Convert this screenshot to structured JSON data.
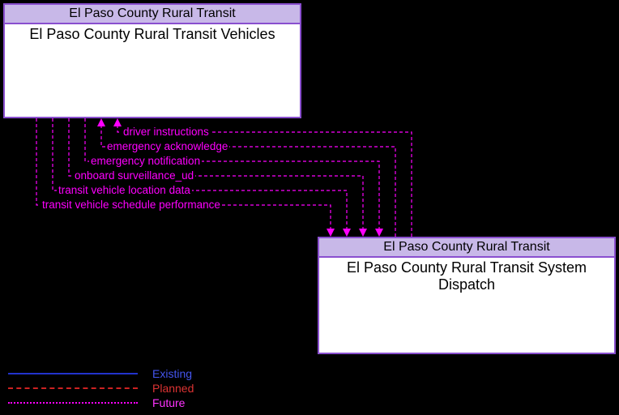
{
  "boxes": {
    "top": {
      "header": "El Paso County Rural Transit",
      "body": "El Paso County Rural Transit Vehicles"
    },
    "bottom": {
      "header": "El Paso County Rural Transit",
      "body": "El Paso County Rural Transit System Dispatch"
    }
  },
  "flows": [
    {
      "label": "driver instructions",
      "dir": "to_top"
    },
    {
      "label": "emergency acknowledge",
      "dir": "to_top"
    },
    {
      "label": "emergency notification",
      "dir": "to_bottom"
    },
    {
      "label": "onboard surveillance_ud",
      "dir": "to_bottom"
    },
    {
      "label": "transit vehicle location data",
      "dir": "to_bottom"
    },
    {
      "label": "transit vehicle schedule performance",
      "dir": "to_bottom"
    }
  ],
  "legend": {
    "existing": "Existing",
    "planned": "Planned",
    "future": "Future"
  }
}
